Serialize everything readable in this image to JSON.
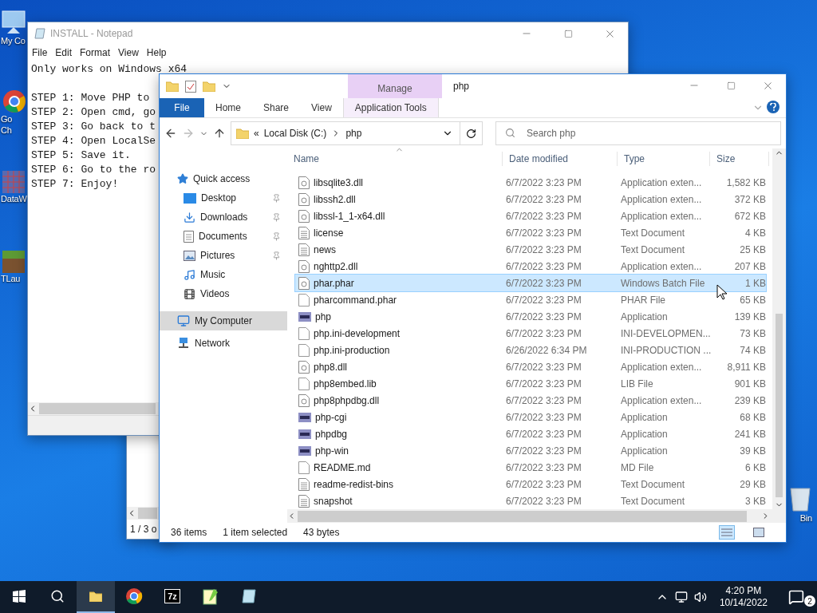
{
  "desktop": {
    "icons": [
      {
        "kind": "computer",
        "lines": [
          "My Co"
        ]
      },
      {
        "kind": "chrome",
        "lines": [
          "Go",
          "Ch"
        ]
      },
      {
        "kind": "data",
        "lines": [
          "DataW"
        ]
      },
      {
        "kind": "game",
        "lines": [
          "TLau"
        ]
      },
      {
        "kind": "bin",
        "lines": [
          "Bin"
        ]
      }
    ]
  },
  "back_window": {
    "status": "1 / 3 o"
  },
  "notepad": {
    "title": "INSTALL - Notepad",
    "menu": [
      "File",
      "Edit",
      "Format",
      "View",
      "Help"
    ],
    "lines": [
      "Only works on Windows x64",
      "STEP 1: Move PHP to",
      "STEP 2: Open cmd, go",
      "STEP 3: Go back to t",
      "STEP 4: Open LocalSe",
      "STEP 5: Save it.",
      "STEP 6: Go to the ro",
      "STEP 7: Enjoy!"
    ]
  },
  "explorer": {
    "context_header": "Manage",
    "title": "php",
    "ribbon_tabs": [
      {
        "label": "File",
        "kind": "file"
      },
      {
        "label": "Home",
        "kind": "tab"
      },
      {
        "label": "Share",
        "kind": "tab"
      },
      {
        "label": "View",
        "kind": "tab"
      },
      {
        "label": "Application Tools",
        "kind": "context"
      }
    ],
    "address": {
      "overflow": "«",
      "segments": [
        "Local Disk (C:)",
        "php"
      ]
    },
    "search": {
      "placeholder": "Search php"
    },
    "nav": [
      {
        "label": "Quick access",
        "kind": "star",
        "selected": false,
        "children": [
          {
            "label": "Desktop",
            "kind": "desktop",
            "pinned": true,
            "selected": false
          },
          {
            "label": "Downloads",
            "kind": "download",
            "pinned": true,
            "selected": false
          },
          {
            "label": "Documents",
            "kind": "document",
            "pinned": true,
            "selected": false
          },
          {
            "label": "Pictures",
            "kind": "picture",
            "pinned": true,
            "selected": false
          },
          {
            "label": "Music",
            "kind": "music",
            "pinned": false,
            "selected": false
          },
          {
            "label": "Videos",
            "kind": "video",
            "pinned": false,
            "selected": false
          }
        ]
      },
      {
        "label": "My Computer",
        "kind": "computer",
        "selected": true
      },
      {
        "label": "Network",
        "kind": "network",
        "selected": false
      }
    ],
    "columns": [
      "Name",
      "Date modified",
      "Type",
      "Size"
    ],
    "rows": [
      {
        "name": "libsqlite3.dll",
        "date": "6/7/2022 3:23 PM",
        "type": "Application exten...",
        "size": "1,582 KB",
        "kind": "dll",
        "selected": false
      },
      {
        "name": "libssh2.dll",
        "date": "6/7/2022 3:23 PM",
        "type": "Application exten...",
        "size": "372 KB",
        "kind": "dll",
        "selected": false
      },
      {
        "name": "libssl-1_1-x64.dll",
        "date": "6/7/2022 3:23 PM",
        "type": "Application exten...",
        "size": "672 KB",
        "kind": "dll",
        "selected": false
      },
      {
        "name": "license",
        "date": "6/7/2022 3:23 PM",
        "type": "Text Document",
        "size": "4 KB",
        "kind": "text",
        "selected": false
      },
      {
        "name": "news",
        "date": "6/7/2022 3:23 PM",
        "type": "Text Document",
        "size": "25 KB",
        "kind": "text",
        "selected": false
      },
      {
        "name": "nghttp2.dll",
        "date": "6/7/2022 3:23 PM",
        "type": "Application exten...",
        "size": "207 KB",
        "kind": "dll",
        "selected": false
      },
      {
        "name": "phar.phar",
        "date": "6/7/2022 3:23 PM",
        "type": "Windows Batch File",
        "size": "1 KB",
        "kind": "batch",
        "selected": true
      },
      {
        "name": "pharcommand.phar",
        "date": "6/7/2022 3:23 PM",
        "type": "PHAR File",
        "size": "65 KB",
        "kind": "blank",
        "selected": false
      },
      {
        "name": "php",
        "date": "6/7/2022 3:23 PM",
        "type": "Application",
        "size": "139 KB",
        "kind": "php",
        "selected": false
      },
      {
        "name": "php.ini-development",
        "date": "6/7/2022 3:23 PM",
        "type": "INI-DEVELOPMEN...",
        "size": "73 KB",
        "kind": "blank",
        "selected": false
      },
      {
        "name": "php.ini-production",
        "date": "6/26/2022 6:34 PM",
        "type": "INI-PRODUCTION ...",
        "size": "74 KB",
        "kind": "blank",
        "selected": false
      },
      {
        "name": "php8.dll",
        "date": "6/7/2022 3:23 PM",
        "type": "Application exten...",
        "size": "8,911 KB",
        "kind": "dll",
        "selected": false
      },
      {
        "name": "php8embed.lib",
        "date": "6/7/2022 3:23 PM",
        "type": "LIB File",
        "size": "901 KB",
        "kind": "blank",
        "selected": false
      },
      {
        "name": "php8phpdbg.dll",
        "date": "6/7/2022 3:23 PM",
        "type": "Application exten...",
        "size": "239 KB",
        "kind": "dll",
        "selected": false
      },
      {
        "name": "php-cgi",
        "date": "6/7/2022 3:23 PM",
        "type": "Application",
        "size": "68 KB",
        "kind": "php",
        "selected": false
      },
      {
        "name": "phpdbg",
        "date": "6/7/2022 3:23 PM",
        "type": "Application",
        "size": "241 KB",
        "kind": "php",
        "selected": false
      },
      {
        "name": "php-win",
        "date": "6/7/2022 3:23 PM",
        "type": "Application",
        "size": "39 KB",
        "kind": "php",
        "selected": false
      },
      {
        "name": "README.md",
        "date": "6/7/2022 3:23 PM",
        "type": "MD File",
        "size": "6 KB",
        "kind": "blank",
        "selected": false
      },
      {
        "name": "readme-redist-bins",
        "date": "6/7/2022 3:23 PM",
        "type": "Text Document",
        "size": "29 KB",
        "kind": "text",
        "selected": false
      },
      {
        "name": "snapshot",
        "date": "6/7/2022 3:23 PM",
        "type": "Text Document",
        "size": "3 KB",
        "kind": "text",
        "selected": false
      }
    ],
    "status": [
      "36 items",
      "1 item selected",
      "43 bytes"
    ],
    "views": [
      {
        "kind": "details",
        "selected": true
      },
      {
        "kind": "tiles",
        "selected": false
      }
    ]
  },
  "taskbar": {
    "apps": [
      {
        "kind": "explorer",
        "selected": true
      },
      {
        "kind": "chrome",
        "selected": false
      },
      {
        "kind": "zip",
        "glyph": "7z",
        "selected": false
      },
      {
        "kind": "notepadpp",
        "selected": false
      },
      {
        "kind": "notepad",
        "selected": false
      }
    ],
    "time": "4:20 PM",
    "date": "10/14/2022",
    "notifications": "2"
  }
}
